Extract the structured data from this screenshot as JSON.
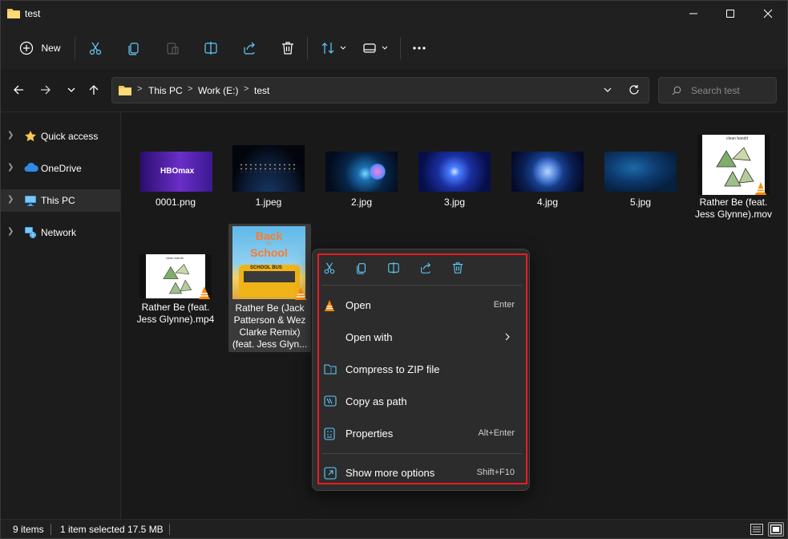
{
  "window": {
    "title": "test",
    "title_icon": "folder-icon"
  },
  "toolbar": {
    "new_label": "New",
    "icons": [
      "plus-icon",
      "cut-icon",
      "copy-icon",
      "paste-icon",
      "rename-icon",
      "share-icon",
      "delete-icon",
      "sort-icon",
      "view-icon",
      "more-icon"
    ]
  },
  "address": {
    "crumbs": [
      "This PC",
      "Work (E:)",
      "test"
    ],
    "search_placeholder": "Search test"
  },
  "sidebar": {
    "items": [
      {
        "label": "Quick access",
        "icon": "star-icon"
      },
      {
        "label": "OneDrive",
        "icon": "cloud-icon"
      },
      {
        "label": "This PC",
        "icon": "monitor-icon",
        "selected": true
      },
      {
        "label": "Network",
        "icon": "network-icon"
      }
    ]
  },
  "files": [
    {
      "name": "0001.png",
      "kind": "image"
    },
    {
      "name": "1.jpeg",
      "kind": "image"
    },
    {
      "name": "2.jpg",
      "kind": "image"
    },
    {
      "name": "3.jpg",
      "kind": "image"
    },
    {
      "name": "4.jpg",
      "kind": "image"
    },
    {
      "name": "5.jpg",
      "kind": "image"
    },
    {
      "name": "Rather Be (feat. Jess Glynne).mov",
      "kind": "video"
    },
    {
      "name": "Rather Be (feat. Jess Glynne).mp4",
      "kind": "video"
    },
    {
      "name": "Rather Be (Jack Patterson & Wez Clarke Remix) (feat. Jess Glyn...",
      "kind": "video",
      "selected": true
    }
  ],
  "thumbs": {
    "hbomax": "HBOmax",
    "clean_bandit": "clean bandit",
    "back": "Back",
    "to": "to",
    "school": "School",
    "school_bus": "SCHOOL BUS"
  },
  "status": {
    "items_count": "9 items",
    "selection": "1 item selected",
    "size": "17.5 MB"
  },
  "context_menu": {
    "toolbar_icons": [
      "cut-icon",
      "copy-icon",
      "rename-icon",
      "share-icon",
      "delete-icon"
    ],
    "items": [
      {
        "label": "Open",
        "shortcut": "Enter",
        "icon": "vlc-icon"
      },
      {
        "label": "Open with",
        "shortcut": "",
        "icon": "",
        "submenu": true
      },
      {
        "label": "Compress to ZIP file",
        "shortcut": "",
        "icon": "zip-icon"
      },
      {
        "label": "Copy as path",
        "shortcut": "",
        "icon": "path-icon"
      },
      {
        "label": "Properties",
        "shortcut": "Alt+Enter",
        "icon": "properties-icon"
      },
      {
        "label": "Show more options",
        "shortcut": "Shift+F10",
        "icon": "more-options-icon"
      }
    ],
    "accent_color": "#e81c24"
  },
  "colors": {
    "accent": "#60cdff",
    "folder": "#f7c94c",
    "highlight": "#e81c24"
  }
}
